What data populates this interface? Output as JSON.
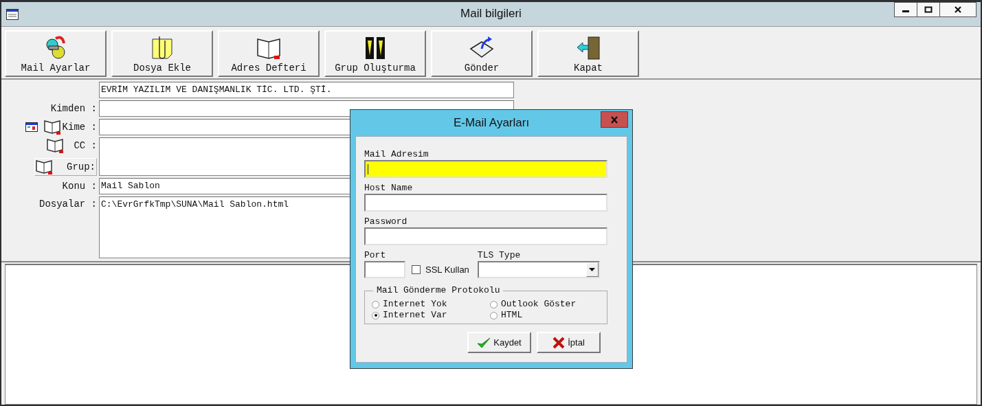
{
  "window": {
    "title": "Mail bilgileri"
  },
  "toolbar": [
    {
      "label": "Mail Ayarlar",
      "kind": "gears"
    },
    {
      "label": "Dosya Ekle",
      "kind": "clip"
    },
    {
      "label": "Adres Defteri",
      "kind": "book"
    },
    {
      "label": "Grup Oluşturma",
      "kind": "group"
    },
    {
      "label": "Gönder",
      "kind": "send"
    },
    {
      "label": "Kapat",
      "kind": "exit"
    }
  ],
  "form": {
    "company": "EVRİM YAZILIM VE DANIŞMANLIK TİC. LTD. ŞTİ.",
    "from_label": "Kimden :",
    "to_label": "Kime :",
    "cc_label": "CC :",
    "group_button": "Grup:",
    "subject_label": "Konu :",
    "subject": "Mail Sablon",
    "files_label": "Dosyalar :",
    "files": [
      "C:\\EvrGrfkTmp\\SUNA\\Mail Sablon.html"
    ]
  },
  "dialog": {
    "title": "E-Mail Ayarları",
    "fields": [
      {
        "label": "Mail Adresim",
        "focused": true
      },
      {
        "label": "Host Name",
        "focused": false
      },
      {
        "label": "Password",
        "focused": false
      }
    ],
    "port_label": "Port",
    "ssl": {
      "label": "SSL Kullan",
      "checked": false
    },
    "tls_label": "TLS Type",
    "protocol": {
      "legend": "Mail Gönderme Protokolu",
      "options": [
        {
          "label": "Internet Yok",
          "selected": false
        },
        {
          "label": "Outlook Göster",
          "selected": false
        },
        {
          "label": "Internet Var",
          "selected": true
        },
        {
          "label": "HTML",
          "selected": false
        }
      ]
    },
    "buttons": [
      {
        "label": "Kaydet",
        "kind": "save"
      },
      {
        "label": "İptal",
        "kind": "cancel"
      }
    ]
  }
}
